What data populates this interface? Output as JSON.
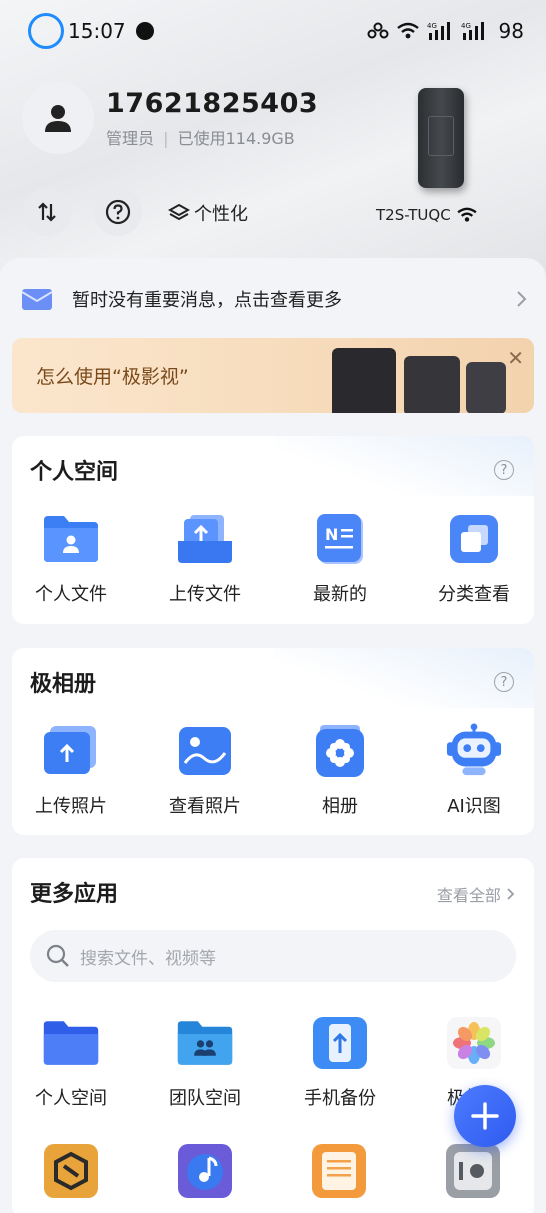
{
  "status_bar": {
    "time": "15:07",
    "battery": "98",
    "net_label_1": "4G",
    "net_label_2": "4G"
  },
  "profile": {
    "phone": "17621825403",
    "role": "管理员",
    "usage": "已使用114.9GB"
  },
  "device": {
    "name": "T2S-TUQC"
  },
  "toolbar": {
    "personalize_label": "个性化"
  },
  "message": {
    "text": "暂时没有重要消息，点击查看更多"
  },
  "banner": {
    "text": "怎么使用“极影视”",
    "close": "✕"
  },
  "personal_space": {
    "title": "个人空间",
    "items": [
      {
        "label": "个人文件",
        "icon": "personal-folder-icon"
      },
      {
        "label": "上传文件",
        "icon": "upload-file-icon"
      },
      {
        "label": "最新的",
        "icon": "recent-notes-icon"
      },
      {
        "label": "分类查看",
        "icon": "category-icon"
      }
    ]
  },
  "album": {
    "title": "极相册",
    "items": [
      {
        "label": "上传照片",
        "icon": "upload-photo-icon"
      },
      {
        "label": "查看照片",
        "icon": "view-photo-icon"
      },
      {
        "label": "相册",
        "icon": "album-icon"
      },
      {
        "label": "AI识图",
        "icon": "ai-robot-icon"
      }
    ]
  },
  "more_apps": {
    "title": "更多应用",
    "see_all": "查看全部",
    "search_placeholder": "搜索文件、视频等",
    "items": [
      {
        "label": "个人空间",
        "icon": "folder-icon"
      },
      {
        "label": "团队空间",
        "icon": "team-folder-icon"
      },
      {
        "label": "手机备份",
        "icon": "phone-backup-icon"
      },
      {
        "label": "极相册",
        "icon": "photos-icon"
      }
    ]
  },
  "colors": {
    "accent": "#2f6bff",
    "banner": "#fbe3c6",
    "fab": "#3d6cf7"
  }
}
